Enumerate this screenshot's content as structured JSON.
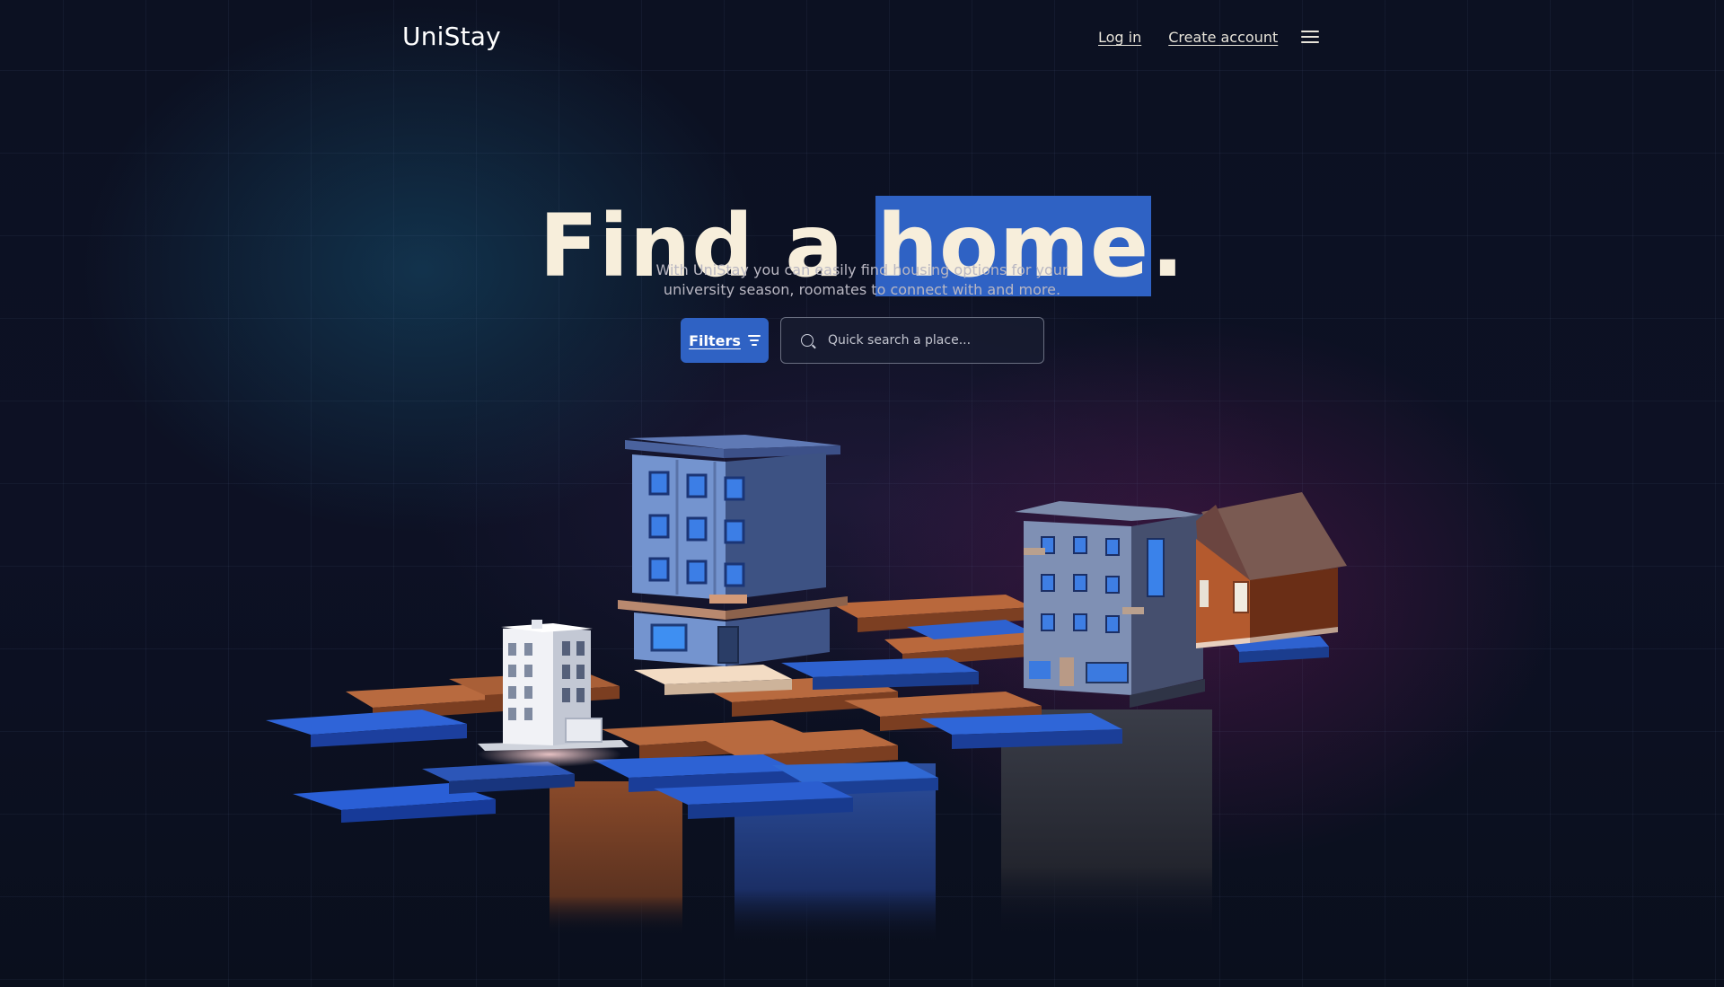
{
  "nav": {
    "logo": "UniStay",
    "login_label": "Log in",
    "create_account_label": "Create account",
    "menu_icon": "hamburger-menu-icon"
  },
  "hero": {
    "title_prefix": "Find a",
    "title_highlight": "home",
    "title_suffix": ".",
    "subtitle_line1": "With UniStay you can easily find housing options for your",
    "subtitle_line2": "university season, roomates to connect with and more."
  },
  "search": {
    "filters_label": "Filters",
    "filters_icon": "filter-icon",
    "search_icon": "search-icon",
    "placeholder": "Quick search a place..."
  },
  "colors": {
    "background": "#0b1020",
    "accent": "#2f62c4",
    "title_text": "#f7eedb",
    "tile_orange": "#b86a3f",
    "tile_blue": "#2c63d6"
  }
}
